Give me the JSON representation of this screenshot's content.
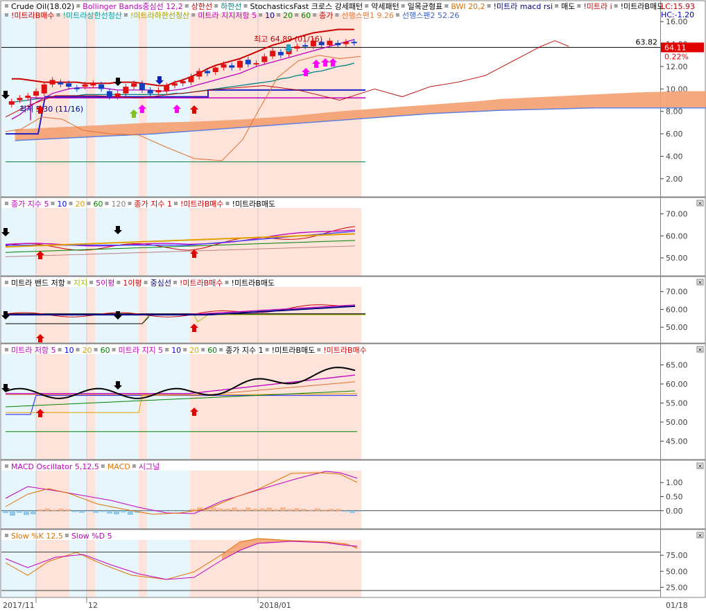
{
  "chart_data": [
    {
      "type": "line",
      "panel": "price",
      "legend": [
        {
          "text": "Crude Oil(18.02)",
          "color": "#000000"
        },
        {
          "text": "Bollinger Bands중심선 12,2",
          "color": "#c000c0"
        },
        {
          "text": "상한선",
          "color": "#cc0000"
        },
        {
          "text": "하한선",
          "color": "#008080"
        },
        {
          "text": "StochasticsFast 크로스 강세패턴",
          "color": "#000000"
        },
        {
          "text": "약세패턴",
          "color": "#000000"
        },
        {
          "text": "일목균형표",
          "color": "#000000"
        },
        {
          "text": "BWI 20,2",
          "color": "#e07000"
        },
        {
          "text": "!미트라 macd rsi",
          "color": "#000080"
        },
        {
          "text": "매도",
          "color": "#000000"
        },
        {
          "text": "!미트라 i",
          "color": "#cc0000"
        },
        {
          "text": "!미트라B매도",
          "color": "#000000"
        },
        {
          "text": "!미트라B매수",
          "color": "#cc0000"
        },
        {
          "text": "!미트라상한선청산",
          "color": "#00a0a0"
        },
        {
          "text": "!미트라하한선청산",
          "color": "#b0a000"
        },
        {
          "text": "미트라 지지저항 5",
          "color": "#c000c0"
        },
        {
          "text": "10",
          "color": "#000080"
        },
        {
          "text": "20",
          "color": "#008000"
        },
        {
          "text": "60",
          "color": "#008000"
        },
        {
          "text": "종가",
          "color": "#cc0000"
        },
        {
          "text": "선행스팬1 9.26",
          "color": "#e08040"
        },
        {
          "text": "선행스팬2 52.26",
          "color": "#4060c0"
        }
      ],
      "corner_labels": [
        "LC:15.93",
        "HC:-1.20"
      ],
      "annotations": [
        "최고 64.89 (01/16)",
        "최저 5.30 (11/16)"
      ],
      "y_ticks": [
        "16.00",
        "14.00",
        "12.00",
        "10.00",
        "8.00",
        "6.00",
        "4.00",
        "2.00"
      ],
      "ylim": [
        1,
        17
      ],
      "reference_value_label": "63.82",
      "current_value_label": "64.11",
      "change_label": "0.22%",
      "candles": {
        "x": [
          2,
          4,
          6,
          8,
          10,
          12,
          14,
          16,
          18,
          20,
          22,
          24,
          26,
          28,
          30,
          32,
          34,
          36,
          38,
          40,
          42,
          44,
          46,
          48,
          50,
          52,
          54,
          56,
          58,
          60,
          62,
          64,
          66,
          68,
          70,
          72,
          74,
          76,
          78,
          80,
          82,
          84,
          86
        ],
        "open": [
          8.6,
          9.0,
          9.2,
          9.4,
          9.6,
          10.4,
          10.6,
          10.5,
          10.1,
          10.2,
          10.3,
          10.4,
          9.8,
          9.3,
          9.6,
          10.2,
          10.5,
          9.9,
          9.7,
          9.8,
          10.3,
          10.5,
          10.6,
          11.1,
          11.6,
          11.5,
          11.9,
          12.1,
          11.9,
          12.6,
          12.2,
          12.4,
          12.9,
          13.3,
          13.1,
          13.6,
          13.9,
          13.8,
          14.2,
          13.9,
          14.1,
          14.0,
          14.2
        ],
        "close": [
          8.9,
          9.2,
          9.4,
          9.8,
          10.4,
          10.8,
          10.4,
          10.2,
          10.0,
          10.4,
          10.5,
          10.0,
          9.3,
          9.6,
          10.2,
          10.5,
          9.9,
          9.6,
          9.9,
          10.3,
          10.5,
          10.7,
          11.1,
          11.6,
          11.4,
          11.9,
          12.2,
          11.9,
          12.5,
          12.2,
          12.3,
          12.9,
          13.4,
          13.0,
          13.6,
          13.8,
          13.8,
          14.3,
          13.9,
          14.3,
          13.9,
          14.2,
          14.1
        ]
      },
      "series": [
        {
          "name": "상한선",
          "color": "#cc0000",
          "values_y": [
            10.9,
            10.9,
            10.8,
            10.7,
            10.6,
            10.6,
            10.6,
            10.6,
            10.6,
            10.5,
            10.5,
            10.5,
            10.5,
            10.6,
            10.6,
            10.6,
            10.5,
            10.4,
            10.3,
            10.3,
            10.6,
            10.8,
            11.1,
            11.4,
            11.8,
            12.1,
            12.3,
            12.5,
            12.7,
            13.0,
            13.3,
            13.6,
            13.9,
            14.1,
            14.3,
            14.6,
            14.8,
            15.0,
            15.1,
            15.2,
            15.3,
            15.3,
            15.3
          ]
        },
        {
          "name": "중심선",
          "color": "#c000c0",
          "values_y": [
            7.3,
            7.7,
            8.3,
            8.8,
            9.2,
            9.6,
            9.8,
            10.0,
            10.1,
            10.1,
            10.1,
            10.1,
            10.0,
            9.9,
            9.9,
            9.9,
            9.9,
            9.9,
            9.8,
            9.8,
            9.9,
            10.0,
            10.2,
            10.4,
            10.6,
            10.8,
            11.0,
            11.2,
            11.4,
            11.7,
            12.0,
            12.2,
            12.4,
            12.6,
            12.8,
            13.0,
            13.2,
            13.4,
            13.6,
            13.8,
            14.0,
            14.2,
            14.4
          ]
        },
        {
          "name": "하한선",
          "color": "#008080",
          "values_y": [
            8.8,
            8.9,
            9.0,
            9.1,
            9.2,
            9.3,
            9.3,
            9.4,
            9.4,
            9.5,
            9.5,
            9.5,
            9.5,
            9.5,
            9.5,
            9.5,
            9.5,
            9.5,
            9.5,
            9.5,
            9.6,
            9.6,
            9.7,
            9.8,
            9.9,
            10.0,
            10.1,
            10.2,
            10.3,
            10.4,
            10.5,
            10.6,
            10.7,
            10.9,
            11.0,
            11.2,
            11.3,
            11.5,
            11.6,
            11.8,
            12.0,
            12.1,
            12.3
          ]
        }
      ],
      "cloud": {
        "span1_color": "#f4a070",
        "span2_color": "#6080e0",
        "x": [
          2,
          10,
          18,
          26,
          34,
          42,
          50,
          58,
          66,
          74,
          82,
          86,
          94,
          102,
          110,
          118,
          126,
          134,
          142,
          150,
          158,
          166,
          174,
          182,
          190,
          198,
          206,
          214,
          222,
          230,
          238,
          246,
          252
        ],
        "span1": [
          6.4,
          6.6,
          6.8,
          7.0,
          7.1,
          7.3,
          7.6,
          8.0,
          8.3,
          8.6,
          8.9,
          9.1,
          9.3,
          9.5,
          9.7,
          9.8,
          9.8,
          9.9,
          9.9,
          9.8,
          9.9,
          10.1,
          10.3,
          10.5,
          10.8,
          11.1,
          11.4,
          11.7,
          12.0,
          12.3,
          12.5,
          12.7,
          12.9
        ],
        "span2": [
          5.4,
          5.6,
          5.8,
          6.0,
          6.3,
          6.6,
          6.9,
          7.2,
          7.5,
          7.8,
          8.0,
          8.1,
          8.2,
          8.3,
          8.3,
          8.3,
          8.3,
          8.3,
          8.3,
          8.3,
          8.4,
          8.5,
          8.7,
          8.9,
          9.1,
          9.4,
          9.7,
          10.0,
          10.4,
          10.7,
          11.1,
          11.4,
          11.4
        ]
      },
      "dates": [
        "2017/11",
        "12",
        "2018/01",
        "01/18"
      ]
    },
    {
      "type": "line",
      "panel": "종가지수",
      "legend": [
        {
          "text": "종가 지수 5",
          "color": "#c000c0"
        },
        {
          "text": "10",
          "color": "#0000ff"
        },
        {
          "text": "20",
          "color": "#e0a000"
        },
        {
          "text": "60",
          "color": "#008000"
        },
        {
          "text": "120",
          "color": "#808080"
        },
        {
          "text": "종가 지수 1",
          "color": "#cc0000"
        },
        {
          "text": "!미트라B매수",
          "color": "#cc0000"
        },
        {
          "text": "!미트라B매도",
          "color": "#000000"
        }
      ],
      "y_ticks": [
        "70.00",
        "60.00",
        "50.00"
      ],
      "ylim": [
        45,
        73
      ]
    },
    {
      "type": "line",
      "panel": "미트라밴드",
      "legend": [
        {
          "text": "미트라 밴드 저항",
          "color": "#000000"
        },
        {
          "text": "지지",
          "color": "#a0c000"
        },
        {
          "text": "5이평",
          "color": "#c000c0"
        },
        {
          "text": "1이평",
          "color": "#cc0000"
        },
        {
          "text": "중심선",
          "color": "#000080"
        },
        {
          "text": "!미트라B매수",
          "color": "#cc0000"
        },
        {
          "text": "!미트라B매도",
          "color": "#000000"
        }
      ],
      "y_ticks": [
        "70.00",
        "60.00",
        "50.00"
      ],
      "ylim": [
        45,
        73
      ]
    },
    {
      "type": "line",
      "panel": "미트라지지저항",
      "legend": [
        {
          "text": "미트라 저항 5",
          "color": "#c000c0"
        },
        {
          "text": "10",
          "color": "#0000ff"
        },
        {
          "text": "20",
          "color": "#e0a000"
        },
        {
          "text": "60",
          "color": "#008000"
        },
        {
          "text": "미트라 지지 5",
          "color": "#c000c0"
        },
        {
          "text": "10",
          "color": "#0000ff"
        },
        {
          "text": "20",
          "color": "#e0a000"
        },
        {
          "text": "60",
          "color": "#008000"
        },
        {
          "text": "종가 지수 1",
          "color": "#000000"
        },
        {
          "text": "!미트라B매도",
          "color": "#000000"
        },
        {
          "text": "!미트라B매수",
          "color": "#cc0000"
        }
      ],
      "y_ticks": [
        "65.00",
        "60.00",
        "55.00",
        "50.00",
        "45.00"
      ],
      "ylim": [
        42,
        68
      ]
    },
    {
      "type": "bar",
      "panel": "MACD",
      "legend": [
        {
          "text": "MACD Oscillator 5,12,5",
          "color": "#c000c0"
        },
        {
          "text": "MACD",
          "color": "#e07000"
        },
        {
          "text": "시그널",
          "color": "#c000c0"
        }
      ],
      "y_ticks": [
        "1.00",
        "0.50",
        "0.00"
      ],
      "ylim": [
        -0.4,
        1.45
      ]
    },
    {
      "type": "line",
      "panel": "Slow Stochastics",
      "legend": [
        {
          "text": "Slow %K 12,5",
          "color": "#e07000"
        },
        {
          "text": "Slow %D 5",
          "color": "#c000c0"
        }
      ],
      "y_ticks": [
        "75.00",
        "50.00",
        "25.00"
      ],
      "ylim": [
        20,
        100
      ]
    }
  ]
}
